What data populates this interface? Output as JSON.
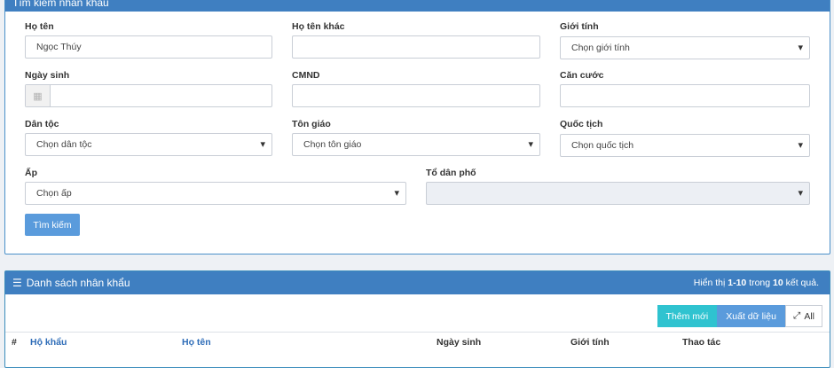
{
  "search_panel": {
    "title": "Tìm kiếm nhân khẩu",
    "fields": {
      "ho_ten": {
        "label": "Họ tên",
        "value": "Ngọc Thúy"
      },
      "ho_ten_khac": {
        "label": "Họ tên khác",
        "value": ""
      },
      "gioi_tinh": {
        "label": "Giới tính",
        "value": "Chọn giới tính"
      },
      "ngay_sinh": {
        "label": "Ngày sinh",
        "value": ""
      },
      "cmnd": {
        "label": "CMND",
        "value": ""
      },
      "can_cuoc": {
        "label": "Căn cước",
        "value": ""
      },
      "dan_toc": {
        "label": "Dân tộc",
        "value": "Chọn dân tộc"
      },
      "ton_giao": {
        "label": "Tôn giáo",
        "value": "Chọn tôn giáo"
      },
      "quoc_tich": {
        "label": "Quốc tịch",
        "value": "Chọn quốc tịch"
      },
      "ap": {
        "label": "Ấp",
        "value": "Chọn ấp"
      },
      "to_dan_pho": {
        "label": "Tổ dân phố",
        "value": ""
      }
    },
    "search_button": "Tìm kiếm"
  },
  "list_panel": {
    "title": "Danh sách nhân khẩu",
    "summary_prefix": "Hiển thị ",
    "summary_range": "1-10",
    "summary_mid": " trong ",
    "summary_total": "10",
    "summary_suffix": " kết quả.",
    "toolbar": {
      "add": "Thêm mới",
      "export": "Xuất dữ liệu",
      "all": "All"
    },
    "columns": [
      "#",
      "Hộ khẩu",
      "Họ tên",
      "Ngày sinh",
      "Giới tính",
      "Thao tác"
    ]
  }
}
